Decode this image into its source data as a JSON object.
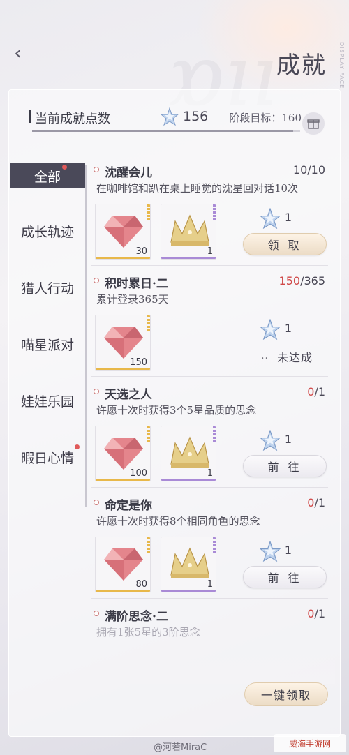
{
  "header": {
    "back_icon": "chevron-left-icon",
    "title": "成就"
  },
  "points": {
    "label": "当前成就点数",
    "value": "156",
    "goal": "阶段目标：160",
    "progress_fraction": 0.975
  },
  "sidebar": {
    "items": [
      {
        "label": "全部",
        "active": true,
        "dot": true
      },
      {
        "label": "成长轨迹",
        "active": false,
        "dot": false
      },
      {
        "label": "猎人行动",
        "active": false,
        "dot": false
      },
      {
        "label": "喵星派对",
        "active": false,
        "dot": false
      },
      {
        "label": "娃娃乐园",
        "active": false,
        "dot": false
      },
      {
        "label": "暇日心情",
        "active": false,
        "dot": true
      }
    ]
  },
  "achievements": [
    {
      "title": "沈醒会儿",
      "progress_current": "10",
      "progress_total": "/10",
      "description": "在咖啡馆和趴在桌上睡觉的沈星回对话10次",
      "rewards": [
        {
          "icon": "diamond-icon",
          "count": "30"
        },
        {
          "icon": "crown-icon",
          "count": "1"
        }
      ],
      "points": "1",
      "action": "领 取"
    },
    {
      "title": "积时累日·二",
      "progress_current": "150",
      "progress_total": "/365",
      "description": "累计登录365天",
      "rewards": [
        {
          "icon": "diamond-icon",
          "count": "150"
        }
      ],
      "points": "1",
      "status": "未达成"
    },
    {
      "title": "天选之人",
      "progress_current": "0",
      "progress_total": "/1",
      "description": "许愿十次时获得3个5星品质的思念",
      "rewards": [
        {
          "icon": "diamond-icon",
          "count": "100"
        },
        {
          "icon": "crown-icon",
          "count": "1"
        }
      ],
      "points": "1",
      "action": "前 往"
    },
    {
      "title": "命定是你",
      "progress_current": "0",
      "progress_total": "/1",
      "description": "许愿十次时获得8个相同角色的思念",
      "rewards": [
        {
          "icon": "diamond-icon",
          "count": "80"
        },
        {
          "icon": "crown-icon",
          "count": "1"
        }
      ],
      "points": "1",
      "action": "前 往"
    },
    {
      "title": "满阶思念·二",
      "progress_current": "0",
      "progress_total": "/1",
      "description": "拥有1张5星的3阶思念"
    }
  ],
  "footer": {
    "claim_all": "一键领取",
    "watermark": "@河若MiraC",
    "site_badge": "威海手游网"
  },
  "colors": {
    "accent_red": "#d04848",
    "sidebar_active": "#4a4959",
    "gold": "#e8b84a",
    "purple": "#a98ad6"
  }
}
